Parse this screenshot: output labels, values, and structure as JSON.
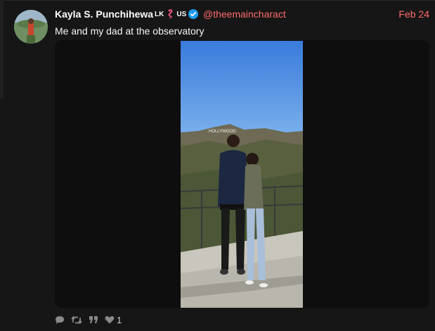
{
  "tweet": {
    "author_name": "Kayla S. Punchihewa",
    "flag_badge_1": "LK",
    "flag_badge_2": "US",
    "handle": "@theemaincharact",
    "date": "Feb 24",
    "text": "Me and my dad at the observatory",
    "image_sign": "HOLLYWOOD"
  },
  "actions": {
    "reply_icon": "speech-bubble-icon",
    "retweet_icon": "retweet-icon",
    "quote_icon": "quote-icon",
    "like_icon": "heart-icon",
    "like_count": "1"
  },
  "colors": {
    "background": "#161616",
    "accent": "#ff6b6b",
    "verified": "#1d9bf0",
    "media_bg": "#0e0e0e"
  }
}
